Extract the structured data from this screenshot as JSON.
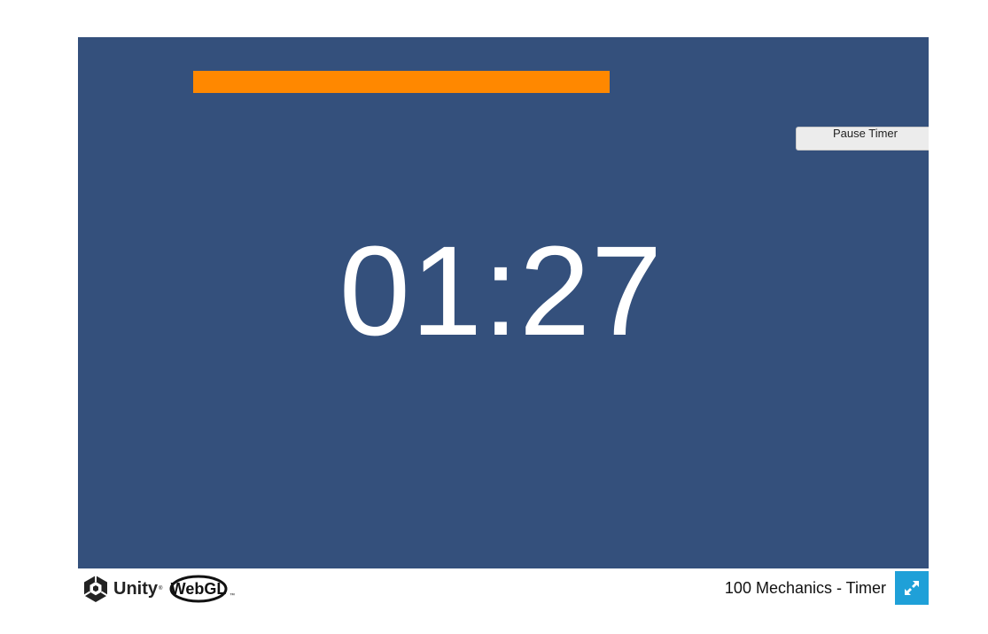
{
  "game": {
    "timer_text": "01:27",
    "progress_fraction": 0.7,
    "pause_label": "Pause Timer"
  },
  "footer": {
    "brand_label": "Unity",
    "webgl_label": "WebGL",
    "title": "100 Mechanics - Timer",
    "fullscreen_icon": "expand-arrows-icon"
  },
  "colors": {
    "canvas_bg": "#34507c",
    "progress_fill": "#ff8800",
    "fullscreen_bg": "#1fa0d8"
  }
}
